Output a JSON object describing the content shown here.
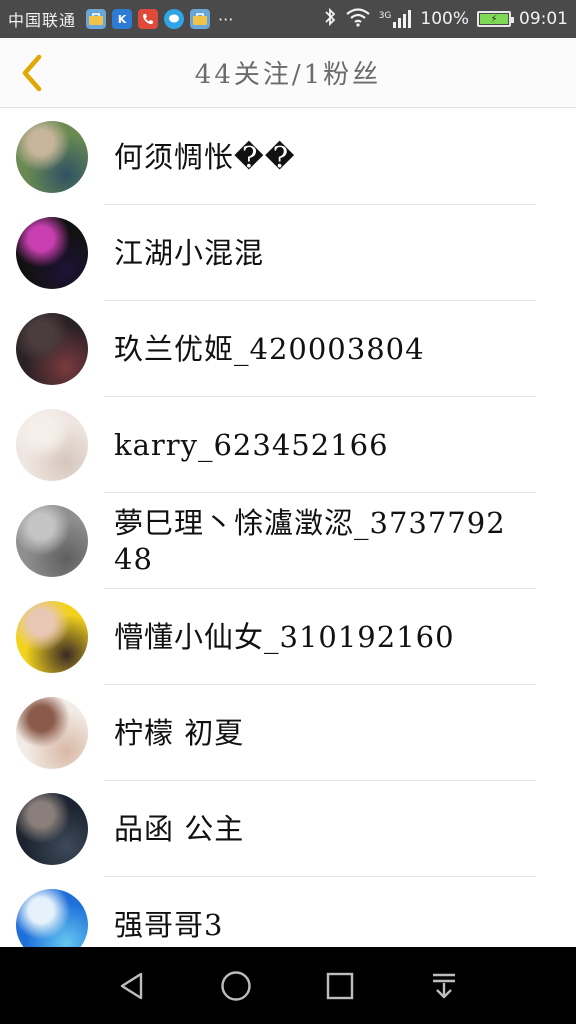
{
  "status_bar": {
    "carrier": "中国联通",
    "more": "···",
    "network": "3G",
    "battery_percent": "100%",
    "battery_level": 1.0,
    "time": "09:01",
    "icons": [
      "bag-icon",
      "k-app-icon",
      "phone-icon",
      "chat-icon",
      "bag-icon",
      "bluetooth-icon",
      "wifi-icon",
      "signal-icon",
      "battery-icon"
    ]
  },
  "header": {
    "title": "44关注/1粉丝",
    "back_icon": "chevron-left-icon",
    "accent_color": "#e0a800"
  },
  "users": [
    {
      "name": "何须惆怅��",
      "avatar_colors": [
        "#6a8a52",
        "#2f5163",
        "#c7b59a"
      ]
    },
    {
      "name": "江湖小混混",
      "avatar_colors": [
        "#111111",
        "#1e1335",
        "#c93fb1"
      ]
    },
    {
      "name": "玖兰优姬_420003804",
      "avatar_colors": [
        "#2b2226",
        "#7a3a3f",
        "#4b3c3e"
      ]
    },
    {
      "name": "karry_623452166",
      "avatar_colors": [
        "#efe6e1",
        "#d6c7bd",
        "#f5efe9"
      ]
    },
    {
      "name": "夢巳理丶悇瀘澂涊_373779248",
      "avatar_colors": [
        "#8f8f8f",
        "#5f5f5f",
        "#c4c4c4"
      ]
    },
    {
      "name": "懵懂小仙女_310192160",
      "avatar_colors": [
        "#f2d21c",
        "#3a2a26",
        "#e8c7b5"
      ]
    },
    {
      "name": "柠檬 初夏",
      "avatar_colors": [
        "#f2ece6",
        "#d9b8a6",
        "#8b5a4a"
      ]
    },
    {
      "name": "品函 公主",
      "avatar_colors": [
        "#1c2430",
        "#3d4a5a",
        "#8a7f7a"
      ]
    },
    {
      "name": "强哥哥3",
      "avatar_colors": [
        "#1e6fd9",
        "#66c8f0",
        "#e6f2fb"
      ]
    }
  ],
  "nav_bar": {
    "buttons": [
      "back-triangle-icon",
      "home-circle-icon",
      "recents-square-icon",
      "notification-pull-icon"
    ]
  }
}
